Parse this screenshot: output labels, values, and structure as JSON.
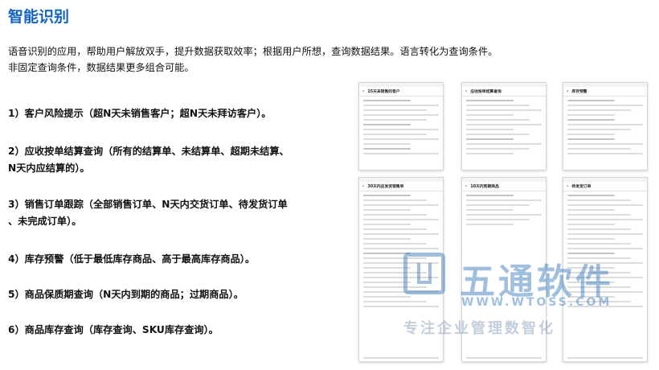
{
  "page": {
    "title": "智能识别",
    "intro": [
      "语音识别的应用，帮助用户解放双手，提升数据获取效率；根据用户所想，查询数据结果。语言转化为查询条件。",
      "非固定查询条件，数据结果更多组合可能。"
    ],
    "features": [
      {
        "lines": [
          "1）客户风险提示（超N天未销售客户；超N天未拜访客户）。"
        ]
      },
      {
        "lines": [
          "2）应收按单结算查询（所有的结算单、未结算单、超期未结算、",
          "N天内应结算的）。"
        ]
      },
      {
        "lines": [
          "3）销售订单跟踪（全部销售订单、N天内交货订单、待发货订单",
          "、未完成订单）。"
        ]
      },
      {
        "lines": [
          "4）库存预警（低于最低库存商品、高于最高库存商品）。"
        ]
      },
      {
        "lines": [
          "5）商品保质期查询（N天内到期的商品；过期商品）。"
        ]
      },
      {
        "lines": [
          "6）商品库存查询（库存查询、SKU库存查询）。"
        ]
      }
    ]
  },
  "phones": [
    {
      "title": "15天未销售的客户"
    },
    {
      "title": "应收按单结算查询"
    },
    {
      "title": "库存预警"
    },
    {
      "title": "30天内应发货销售单"
    },
    {
      "title": "10天内到期商品"
    },
    {
      "title": "待发货订单"
    }
  ],
  "watermark": {
    "brand": "五通软件",
    "url": "WWW.WTOSS.COM",
    "slogan": "专注企业管理数智化"
  },
  "colors": {
    "title": "#1565c0",
    "watermark": "#2f72b8"
  }
}
